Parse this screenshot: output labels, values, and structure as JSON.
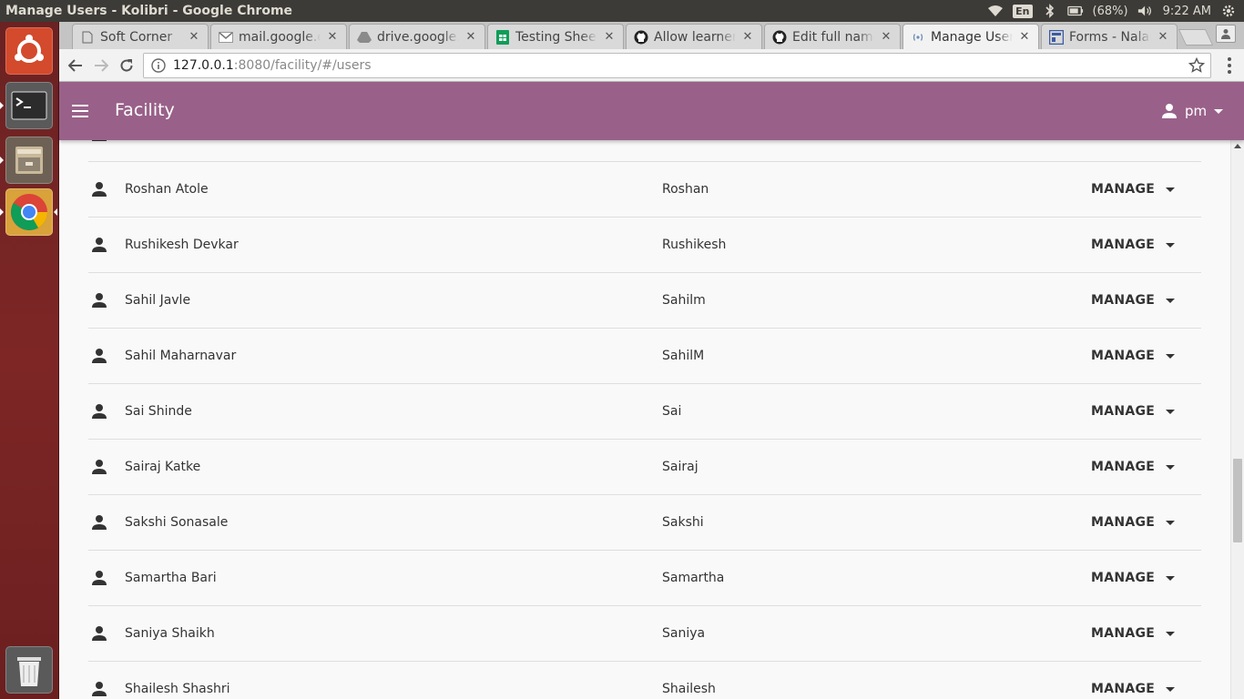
{
  "os": {
    "window_title": "Manage Users - Kolibri - Google Chrome",
    "lang": "En",
    "battery": "(68%)",
    "clock": "9:22 AM"
  },
  "browser": {
    "tabs": [
      {
        "label": "Soft Corner",
        "favicon": "page-icon"
      },
      {
        "label": "mail.google.com",
        "favicon": "gmail-icon"
      },
      {
        "label": "drive.google.com",
        "favicon": "drive-icon"
      },
      {
        "label": "Testing Sheet",
        "favicon": "sheets-icon"
      },
      {
        "label": "Allow learner",
        "favicon": "github-icon"
      },
      {
        "label": "Edit full name",
        "favicon": "github-icon"
      },
      {
        "label": "Manage Users",
        "favicon": "loading-icon"
      },
      {
        "label": "Forms - Nalanda",
        "favicon": "forms-icon"
      }
    ],
    "close_glyph": "✕",
    "url_host": "127.0.0.1",
    "url_rest": ":8080/facility/#/users"
  },
  "app": {
    "title": "Facility",
    "user_name": "pm",
    "accent_color": "#996189"
  },
  "users": {
    "manage_label": "MANAGE",
    "rows": [
      {
        "fullname": "",
        "username": ""
      },
      {
        "fullname": "Roshan Atole",
        "username": "Roshan"
      },
      {
        "fullname": "Rushikesh Devkar",
        "username": "Rushikesh"
      },
      {
        "fullname": "Sahil Javle",
        "username": "Sahilm"
      },
      {
        "fullname": "Sahil Maharnavar",
        "username": "SahilM"
      },
      {
        "fullname": "Sai Shinde",
        "username": "Sai"
      },
      {
        "fullname": "Sairaj Katke",
        "username": "Sairaj"
      },
      {
        "fullname": "Sakshi Sonasale",
        "username": "Sakshi"
      },
      {
        "fullname": "Samartha Bari",
        "username": "Samartha"
      },
      {
        "fullname": "Saniya Shaikh",
        "username": "Saniya"
      },
      {
        "fullname": "Shailesh Shashri",
        "username": "Shailesh"
      }
    ]
  }
}
